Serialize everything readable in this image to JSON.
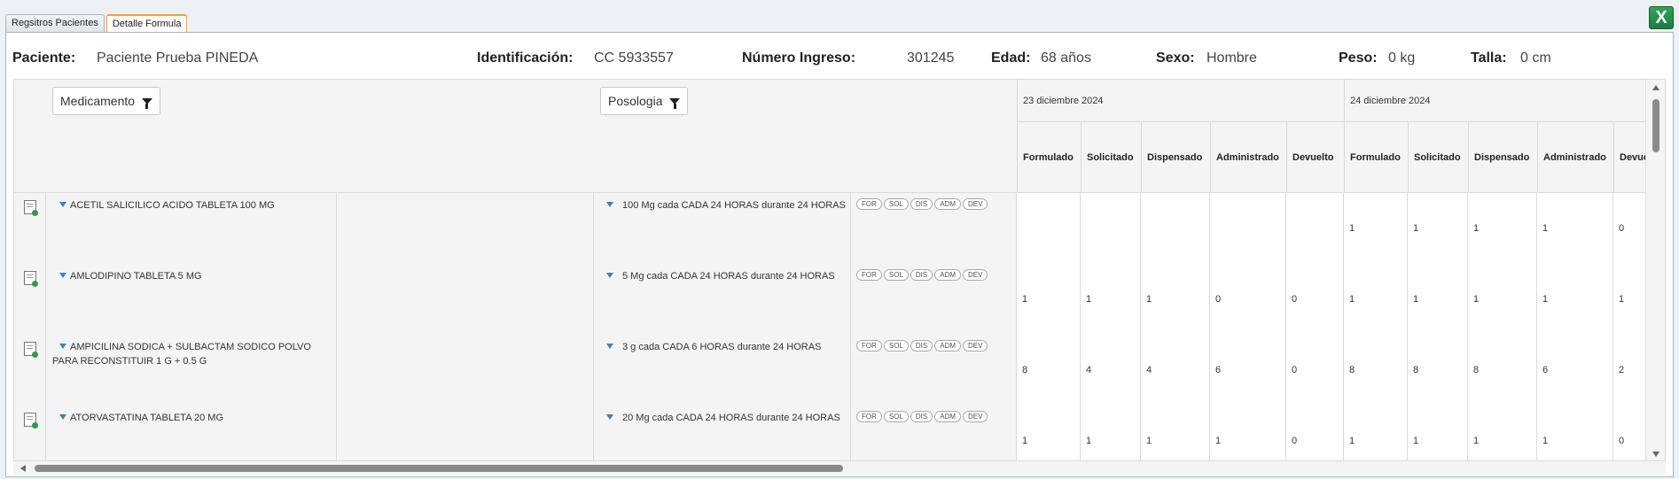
{
  "tabs": [
    {
      "label": "Regsitros Pacientes"
    },
    {
      "label": "Detalle Formula"
    }
  ],
  "export_icon": {
    "glyph": "X",
    "color": "#1d7a3e",
    "name": "excel-icon"
  },
  "patient": {
    "paciente_label": "Paciente:",
    "paciente_value": "Paciente Prueba PINEDA",
    "id_label": "Identificación:",
    "id_value": "CC 5933557",
    "ingreso_label": "Número Ingreso:",
    "ingreso_value": "301245",
    "edad_label": "Edad:",
    "edad_value": "68 años",
    "sexo_label": "Sexo:",
    "sexo_value": "Hombre",
    "peso_label": "Peso:",
    "peso_value": "0 kg",
    "talla_label": "Talla:",
    "talla_value": "0 cm"
  },
  "filters": {
    "medicamento": "Medicamento",
    "posologia": "Posologia"
  },
  "chips": [
    "FOR",
    "SOL",
    "DIS",
    "ADM",
    "DEV"
  ],
  "dates": [
    "23 diciembre 2024",
    "24 diciembre 2024"
  ],
  "columns": [
    "Formulado",
    "Solicitado",
    "Dispensado",
    "Administrado",
    "Devuelto"
  ],
  "rows": [
    {
      "medicamento": "ACETIL SALICILICO ACIDO TABLETA 100 MG",
      "posologia": "100 Mg cada CADA 24 HORAS durante 24 HORAS",
      "day1": [
        "",
        "",
        "",
        "",
        ""
      ],
      "day2": [
        "1",
        "1",
        "1",
        "1",
        "0"
      ]
    },
    {
      "medicamento": "AMLODIPINO TABLETA 5 MG",
      "posologia": "5 Mg cada CADA 24 HORAS durante 24 HORAS",
      "day1": [
        "1",
        "1",
        "1",
        "0",
        "0"
      ],
      "day2": [
        "1",
        "1",
        "1",
        "1",
        "1"
      ]
    },
    {
      "medicamento": "AMPICILINA SODICA + SULBACTAM SODICO POLVO PARA RECONSTITUIR 1 G + 0.5 G",
      "posologia": "3 g cada CADA 6 HORAS durante 24 HORAS",
      "day1": [
        "8",
        "4",
        "4",
        "6",
        "0"
      ],
      "day2": [
        "8",
        "8",
        "8",
        "6",
        "2"
      ]
    },
    {
      "medicamento": "ATORVASTATINA TABLETA 20 MG",
      "posologia": "20 Mg cada CADA 24 HORAS durante 24 HORAS",
      "day1": [
        "1",
        "1",
        "1",
        "1",
        "0"
      ],
      "day2": [
        "1",
        "1",
        "1",
        "1",
        "0"
      ]
    }
  ]
}
